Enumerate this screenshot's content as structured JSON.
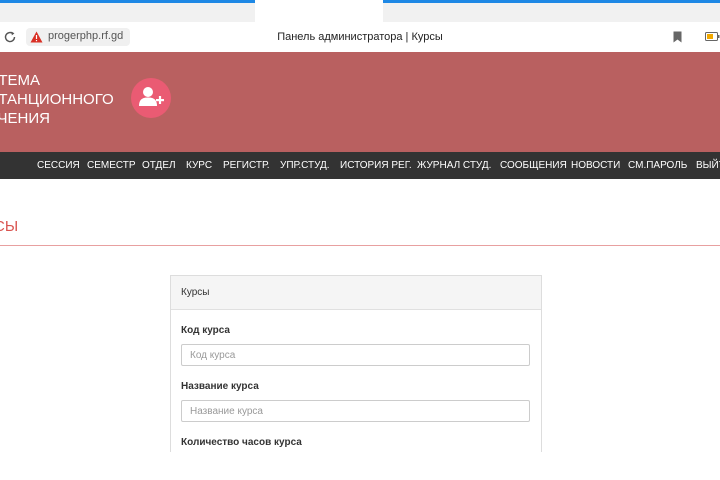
{
  "browser": {
    "url": "progerphp.rf.gd",
    "tab_title": "Панель администратора | Курсы"
  },
  "header": {
    "title_lines": [
      "СТЕМА",
      "СТАНЦИОННОГО",
      "УЧЕНИЯ"
    ],
    "logo_icon": "user-plus-icon",
    "bg_color": "#b96060",
    "logo_color": "#ea5b73"
  },
  "nav": {
    "items": [
      "СЕССИЯ",
      "СЕМЕСТР",
      "ОТДЕЛ",
      "КУРС",
      "РЕГИСТР.",
      "УПР.СТУД.",
      "ИСТОРИЯ РЕГ.",
      "ЖУРНАЛ СТУД.",
      "СООБЩЕНИЯ",
      "НОВОСТИ",
      "СМ.ПАРОЛЬ",
      "ВЫЙТ"
    ]
  },
  "page": {
    "heading": "СЫ"
  },
  "panel": {
    "title": "Курсы",
    "fields": [
      {
        "label": "Код курса",
        "placeholder": "Код курса",
        "value": ""
      },
      {
        "label": "Название курса",
        "placeholder": "Название курса",
        "value": ""
      },
      {
        "label": "Количество часов курса"
      }
    ]
  }
}
